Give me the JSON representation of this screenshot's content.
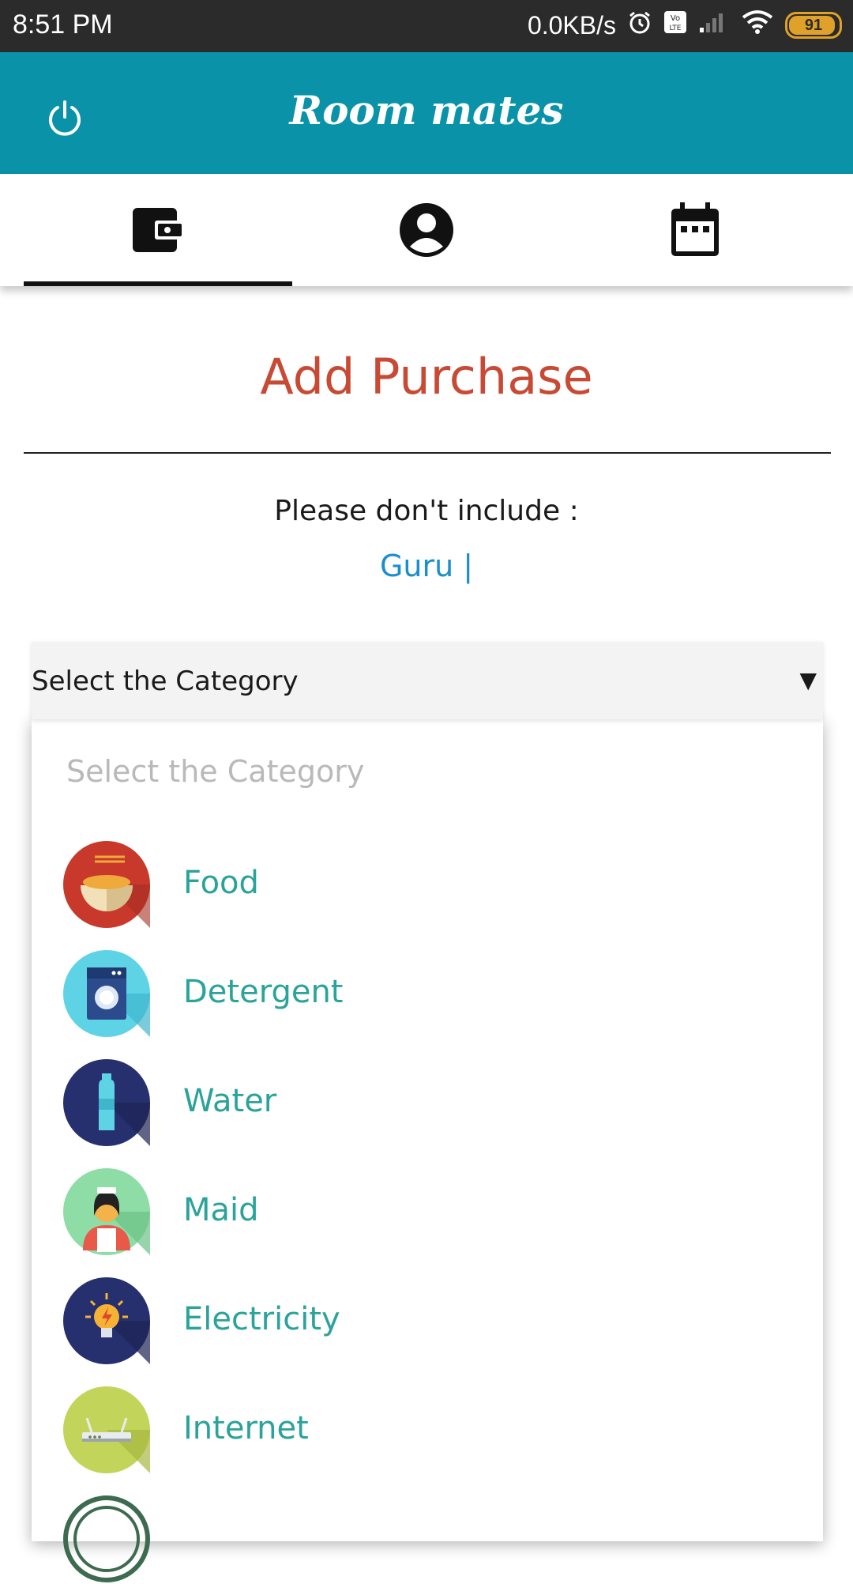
{
  "status_bar": {
    "time": "8:51 PM",
    "network_speed": "0.0KB/s",
    "battery": "91"
  },
  "app_bar": {
    "title": "Room mates"
  },
  "tabs": [
    {
      "name": "wallet",
      "icon": "wallet-icon",
      "selected": true
    },
    {
      "name": "profile",
      "icon": "account-circle-icon",
      "selected": false
    },
    {
      "name": "calendar",
      "icon": "calendar-icon",
      "selected": false
    }
  ],
  "page": {
    "heading": "Add Purchase",
    "note": "Please don't include :",
    "excluded_members": "Guru |"
  },
  "category_select": {
    "selected_label": "Select the Category",
    "placeholder": "Select the Category",
    "options": [
      {
        "label": "Food",
        "icon": "food-bowl-icon"
      },
      {
        "label": "Detergent",
        "icon": "washing-machine-icon"
      },
      {
        "label": "Water",
        "icon": "water-bottle-icon"
      },
      {
        "label": "Maid",
        "icon": "maid-icon"
      },
      {
        "label": "Electricity",
        "icon": "light-bulb-icon"
      },
      {
        "label": "Internet",
        "icon": "router-icon"
      }
    ]
  },
  "colors": {
    "app_bar": "#0a93a8",
    "heading": "#c84a34",
    "option_text": "#2aa39a",
    "excluded_text": "#1a8fcf"
  }
}
